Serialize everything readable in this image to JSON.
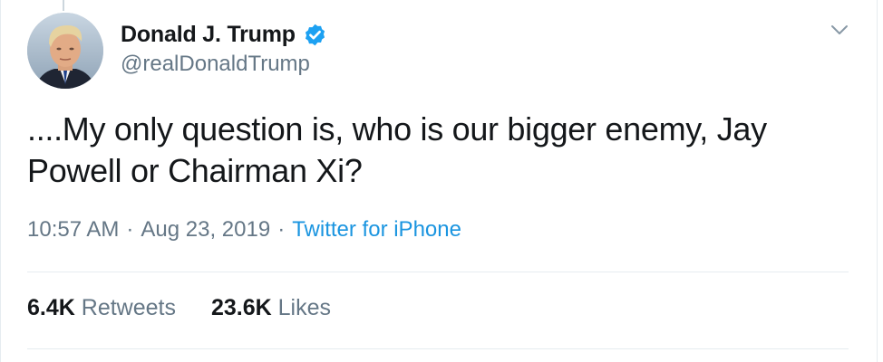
{
  "tweet": {
    "author": {
      "display_name": "Donald J. Trump",
      "handle": "@realDonaldTrump",
      "verified": true
    },
    "text": "....My only question is, who is our bigger enemy, Jay Powell or Chairman Xi?",
    "time": "10:57 AM",
    "separator": "·",
    "date": "Aug 23, 2019",
    "source": "Twitter for iPhone",
    "stats": {
      "retweets_count": "6.4K",
      "retweets_label": "Retweets",
      "likes_count": "23.6K",
      "likes_label": "Likes"
    }
  },
  "icons": {
    "verified": "verified-badge-icon",
    "caret": "chevron-down-icon"
  },
  "colors": {
    "text_primary": "#14171a",
    "text_secondary": "#657786",
    "link": "#1b95e0",
    "verified": "#1da1f2",
    "divider": "#e6ecf0"
  }
}
